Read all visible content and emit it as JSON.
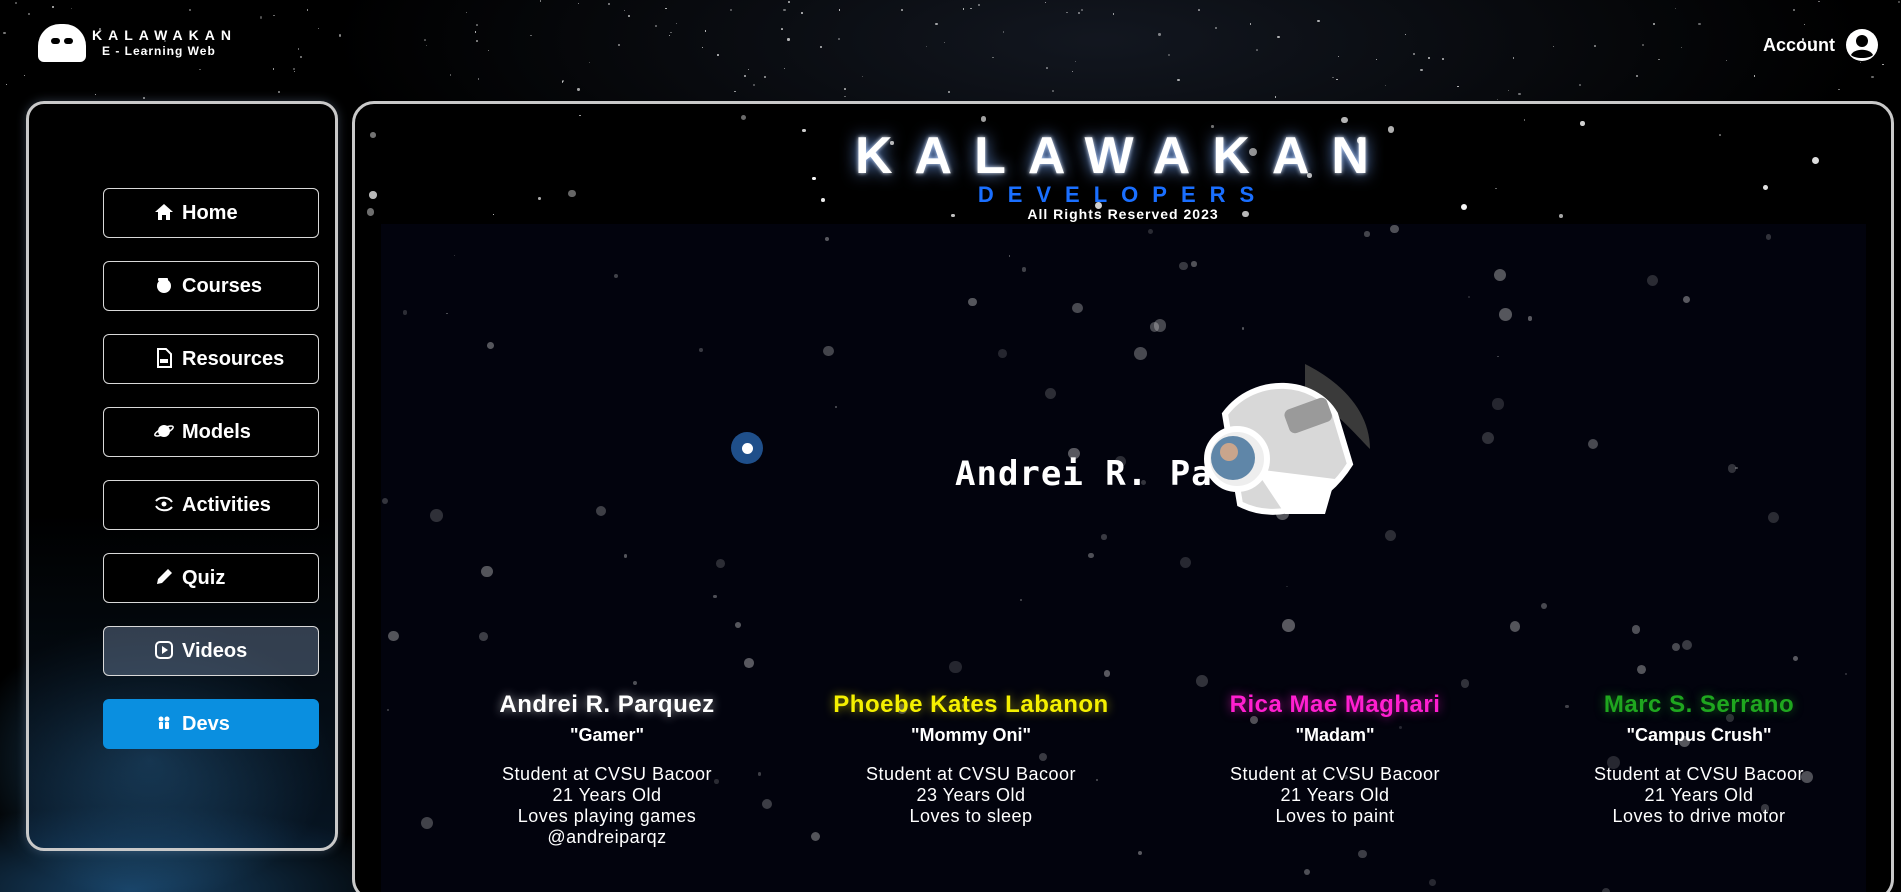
{
  "brand": {
    "name": "KALAWAKAN",
    "subtitle": "E - Learning Web"
  },
  "account": {
    "label": "Account",
    "icon": "user-circle-icon"
  },
  "sidebar": {
    "items": [
      {
        "label": "Home",
        "icon": "home-icon"
      },
      {
        "label": "Courses",
        "icon": "courses-icon"
      },
      {
        "label": "Resources",
        "icon": "file-icon"
      },
      {
        "label": "Models",
        "icon": "planet-icon"
      },
      {
        "label": "Activities",
        "icon": "galaxy-icon"
      },
      {
        "label": "Quiz",
        "icon": "pencil-icon"
      },
      {
        "label": "Videos",
        "icon": "video-icon"
      },
      {
        "label": "Devs",
        "icon": "people-icon"
      }
    ],
    "active": "Devs",
    "hovered": "Videos"
  },
  "main": {
    "title": "KALAWAKAN",
    "subtitle": "DEVELOPERS",
    "rights": "All Rights Reserved 2023",
    "featured_name": "Andrei R. Parquez"
  },
  "devs": [
    {
      "name": "Andrei R. Parquez",
      "nickname": "\"Gamer\"",
      "color": "#ffffff",
      "info": [
        "Student at CVSU Bacoor",
        "21 Years Old",
        "Loves playing games",
        "@andreiparqz"
      ]
    },
    {
      "name": "Phoebe Kates Labanon",
      "nickname": "\"Mommy Oni\"",
      "color": "#f5f000",
      "info": [
        "Student at CVSU Bacoor",
        "23 Years Old",
        "Loves to sleep"
      ]
    },
    {
      "name": "Rica Mae Maghari",
      "nickname": "\"Madam\"",
      "color": "#ff1fd0",
      "info": [
        "Student at CVSU Bacoor",
        "21 Years Old",
        "Loves to paint"
      ]
    },
    {
      "name": "Marc S. Serrano",
      "nickname": "\"Campus Crush\"",
      "color": "#1fa61f",
      "info": [
        "Student at CVSU Bacoor",
        "21 Years Old",
        "Loves to drive motor"
      ]
    }
  ],
  "colors": {
    "accent": "#0a8fe0",
    "developers_blue": "#1a6fff"
  }
}
